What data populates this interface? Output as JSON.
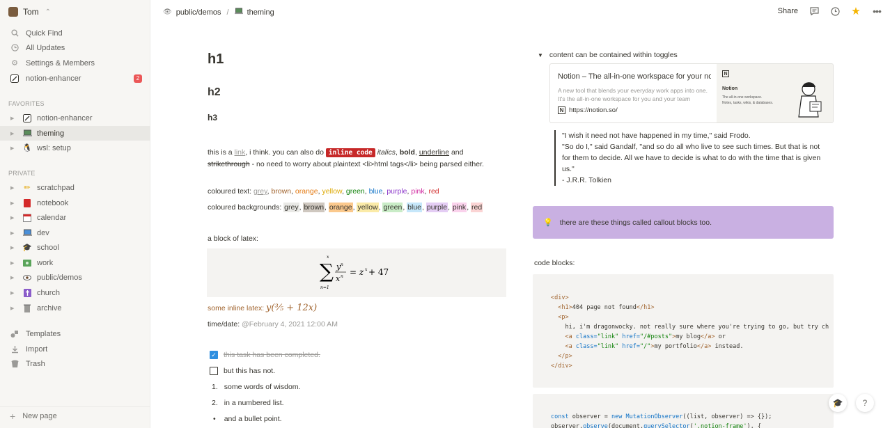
{
  "sidebar": {
    "workspace": "Tom",
    "top_items": [
      {
        "icon": "search-icon",
        "label": "Quick Find"
      },
      {
        "icon": "clock-icon",
        "label": "All Updates"
      },
      {
        "icon": "gear-icon",
        "label": "Settings & Members"
      },
      {
        "icon": "notion-enhancer-icon",
        "label": "notion-enhancer",
        "badge": "2"
      }
    ],
    "favorites_label": "FAVORITES",
    "favorites": [
      {
        "icon": "notion-enhancer-icon",
        "label": "notion-enhancer"
      },
      {
        "icon": "laptop-icon",
        "label": "theming",
        "active": true
      },
      {
        "icon": "penguin-icon",
        "label": "wsl: setup"
      }
    ],
    "private_label": "PRIVATE",
    "private": [
      {
        "icon": "pencil-icon",
        "label": "scratchpad"
      },
      {
        "icon": "book-icon",
        "label": "notebook"
      },
      {
        "icon": "calendar-icon",
        "label": "calendar"
      },
      {
        "icon": "computer-icon",
        "label": "dev"
      },
      {
        "icon": "graduation-cap-icon",
        "label": "school"
      },
      {
        "icon": "money-icon",
        "label": "work"
      },
      {
        "icon": "eye-icon",
        "label": "public/demos"
      },
      {
        "icon": "cross-icon",
        "label": "church"
      },
      {
        "icon": "trash-can-icon",
        "label": "archive"
      }
    ],
    "bottom_items": [
      {
        "icon": "templates-icon",
        "label": "Templates"
      },
      {
        "icon": "import-icon",
        "label": "Import"
      },
      {
        "icon": "trash-icon",
        "label": "Trash"
      }
    ],
    "new_page": "New page"
  },
  "topbar": {
    "crumb1": "public/demos",
    "crumb_sep": "/",
    "crumb2": "theming",
    "share": "Share"
  },
  "content": {
    "h1": "h1",
    "h2": "h2",
    "h3": "h3",
    "p1": {
      "a": "this is a ",
      "link": "link",
      "b": ", i think. you can also do ",
      "code": "inline code",
      "c": " ",
      "italic": "italics",
      "d": ", ",
      "bold": "bold",
      "e": ", ",
      "underline": "underline",
      "f": " and ",
      "strike": "strikethrough",
      "g": " - no need to worry about plaintext <li>html tags</li> being parsed either."
    },
    "coloured_text_label": "coloured text: ",
    "coloured_bg_label": "coloured backgrounds: ",
    "colours": [
      "grey",
      "brown",
      "orange",
      "yellow",
      "green",
      "blue",
      "purple",
      "pink",
      "red"
    ],
    "latex_label": "a block of latex:",
    "inline_latex_label": "some inline latex: ",
    "datetime_label": "time/date: ",
    "datetime_value": "@February 4, 2021 12:00 AM",
    "todo_done": "this task has been completed.",
    "todo_open": "but this has not.",
    "numbered": [
      {
        "n": "1.",
        "text": "some words of wisdom."
      },
      {
        "n": "2.",
        "text": "in a numbered list."
      }
    ],
    "bullet": {
      "n": "•",
      "text": "and a bullet point."
    },
    "toggle": "content can be contained within toggles",
    "bookmark": {
      "title": "Notion – The all-in-one workspace for your notes, tasks, wikis, and databases.",
      "desc": "A new tool that blends your everyday work apps into one. It's the all-in-one workspace for you and your team",
      "url": "https://notion.so/",
      "thumb_title": "Notion",
      "thumb_sub1": "The all-in-one workspace.",
      "thumb_sub2": "Notes, tasks, wikis, & databases."
    },
    "quote": [
      "\"I wish it need not have happened in my time,\" said Frodo.",
      "\"So do I,\" said Gandalf, \"and so do all who live to see such times. But that is not for them to decide. All we have to decide is what to do with the time that is given us.\"",
      "- J.R.R. Tolkien"
    ],
    "callout": "there are these things called callout blocks too.",
    "code_label": "code blocks:",
    "accent_color": "#2f8fe0",
    "callout_color": "#c9b0e2",
    "inline_code_color": "#c62828"
  }
}
